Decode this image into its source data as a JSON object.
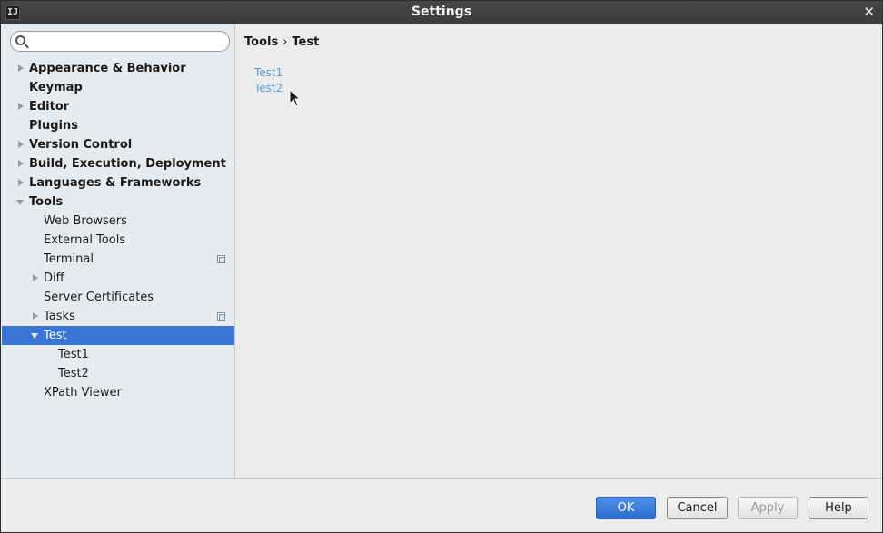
{
  "window": {
    "logo_text": "IJ",
    "title": "Settings",
    "close_glyph": "✕"
  },
  "search": {
    "value": "",
    "placeholder": ""
  },
  "tree": [
    {
      "label": "Appearance & Behavior",
      "level": 0,
      "arrow": "collapsed"
    },
    {
      "label": "Keymap",
      "level": 0,
      "arrow": "none"
    },
    {
      "label": "Editor",
      "level": 0,
      "arrow": "collapsed"
    },
    {
      "label": "Plugins",
      "level": 0,
      "arrow": "none"
    },
    {
      "label": "Version Control",
      "level": 0,
      "arrow": "collapsed"
    },
    {
      "label": "Build, Execution, Deployment",
      "level": 0,
      "arrow": "collapsed"
    },
    {
      "label": "Languages & Frameworks",
      "level": 0,
      "arrow": "collapsed"
    },
    {
      "label": "Tools",
      "level": 0,
      "arrow": "expanded"
    },
    {
      "label": "Web Browsers",
      "level": 1,
      "arrow": "none"
    },
    {
      "label": "External Tools",
      "level": 1,
      "arrow": "none"
    },
    {
      "label": "Terminal",
      "level": 1,
      "arrow": "none",
      "project_icon": "project-level-icon"
    },
    {
      "label": "Diff",
      "level": 1,
      "arrow": "collapsed"
    },
    {
      "label": "Server Certificates",
      "level": 1,
      "arrow": "none"
    },
    {
      "label": "Tasks",
      "level": 1,
      "arrow": "collapsed",
      "project_icon": "project-level-icon"
    },
    {
      "label": "Test",
      "level": 1,
      "arrow": "expanded",
      "selected": true
    },
    {
      "label": "Test1",
      "level": 2,
      "arrow": "none"
    },
    {
      "label": "Test2",
      "level": 2,
      "arrow": "none"
    },
    {
      "label": "XPath Viewer",
      "level": 1,
      "arrow": "none"
    }
  ],
  "content": {
    "breadcrumb": [
      "Tools",
      "Test"
    ],
    "breadcrumb_separator": "›",
    "links": [
      "Test1",
      "Test2"
    ]
  },
  "buttons": {
    "ok": "OK",
    "cancel": "Cancel",
    "apply": "Apply",
    "help": "Help"
  },
  "colors": {
    "selection": "#3875d7",
    "link": "#5a9fd4",
    "primary_button": "#2d6fcf"
  }
}
